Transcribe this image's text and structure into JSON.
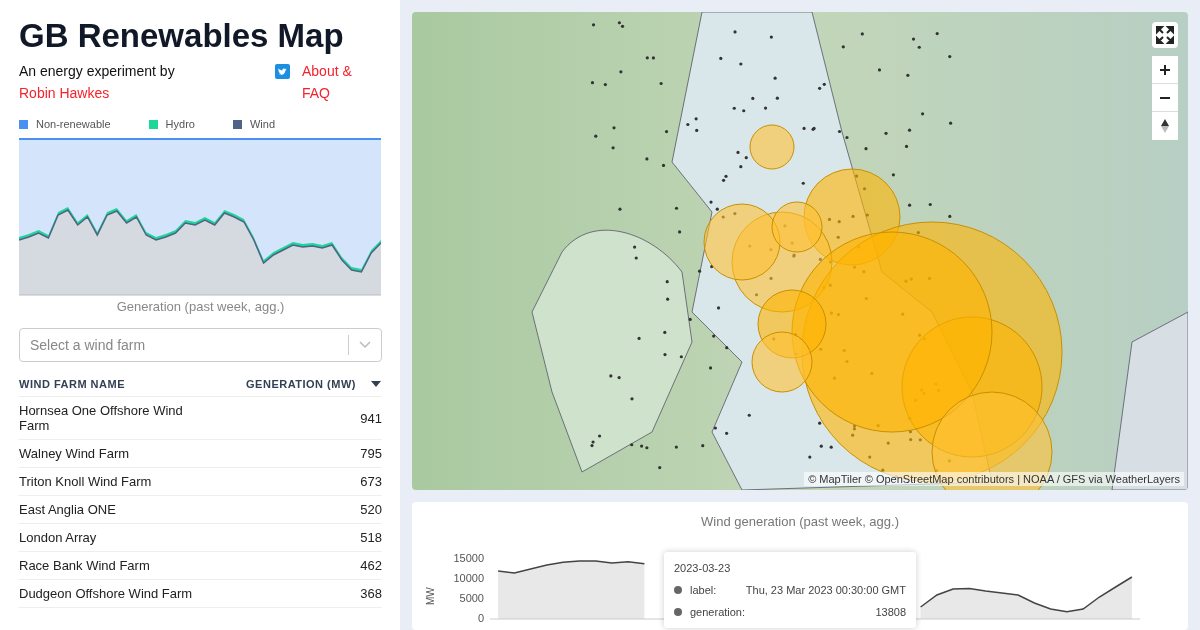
{
  "header": {
    "title": "GB Renewables Map",
    "byline": "An energy experiment by",
    "author_link": "Robin Hawkes",
    "about_link": "About & FAQ"
  },
  "generation_chart": {
    "legend": [
      {
        "label": "Non-renewable",
        "color": "#4a90f0"
      },
      {
        "label": "Hydro",
        "color": "#1ed69a"
      },
      {
        "label": "Wind",
        "color": "#4f6384"
      }
    ],
    "caption": "Generation (past week, agg.)"
  },
  "wind_farm_select": {
    "placeholder": "Select a wind farm"
  },
  "table": {
    "columns": [
      "WIND FARM NAME",
      "GENERATION (MW)"
    ],
    "rows": [
      {
        "name": "Hornsea One Offshore Wind Farm",
        "generation": "941"
      },
      {
        "name": "Walney Wind Farm",
        "generation": "795"
      },
      {
        "name": "Triton Knoll Wind Farm",
        "generation": "673"
      },
      {
        "name": "East Anglia ONE",
        "generation": "520"
      },
      {
        "name": "London Array",
        "generation": "518"
      },
      {
        "name": "Race Bank Wind Farm",
        "generation": "462"
      },
      {
        "name": "Dudgeon Offshore Wind Farm",
        "generation": "368"
      }
    ]
  },
  "map": {
    "attribution": "© MapTiler © OpenStreetMap contributors | NOAA / GFS via WeatherLayers"
  },
  "wind_chart": {
    "title": "Wind generation (past week, agg.)",
    "chart_data": {
      "type": "area",
      "ylabel": "MW",
      "ylim": [
        0,
        15000
      ],
      "yticks": [
        0,
        5000,
        10000,
        15000
      ],
      "series": [
        {
          "color": "#444444",
          "values": [
            12000,
            11500,
            12500,
            13500,
            14200,
            14500,
            14500,
            14000,
            14300,
            13800,
            null,
            null,
            null,
            null,
            null,
            null,
            null,
            null,
            null,
            null,
            null,
            null,
            null,
            null,
            null,
            null,
            3000,
            6000,
            7500,
            7600,
            7000,
            6500,
            6000,
            4000,
            2500,
            1800,
            2500,
            5500,
            8000,
            10500
          ]
        }
      ]
    },
    "tooltip": {
      "date": "2023-03-23",
      "rows": [
        {
          "key": "label:",
          "value": "Thu, 23 Mar 2023 00:30:00 GMT"
        },
        {
          "key": "generation:",
          "value": "13808"
        }
      ]
    }
  }
}
